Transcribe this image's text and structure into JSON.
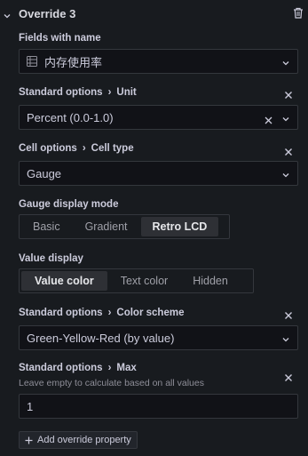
{
  "header": {
    "title": "Override 3"
  },
  "fields_with_name": {
    "label": "Fields with name",
    "value": "内存使用率"
  },
  "unit": {
    "category": "Standard options",
    "name": "Unit",
    "value": "Percent (0.0-1.0)"
  },
  "cell_type": {
    "category": "Cell options",
    "name": "Cell type",
    "value": "Gauge"
  },
  "gauge_display_mode": {
    "label": "Gauge display mode",
    "options": [
      "Basic",
      "Gradient",
      "Retro LCD"
    ],
    "selected": "Retro LCD"
  },
  "value_display": {
    "label": "Value display",
    "options": [
      "Value color",
      "Text color",
      "Hidden"
    ],
    "selected": "Value color"
  },
  "color_scheme": {
    "category": "Standard options",
    "name": "Color scheme",
    "value": "Green-Yellow-Red (by value)"
  },
  "max": {
    "category": "Standard options",
    "name": "Max",
    "description": "Leave empty to calculate based on all values",
    "value": "1"
  },
  "add_override": {
    "label": "Add override property"
  }
}
